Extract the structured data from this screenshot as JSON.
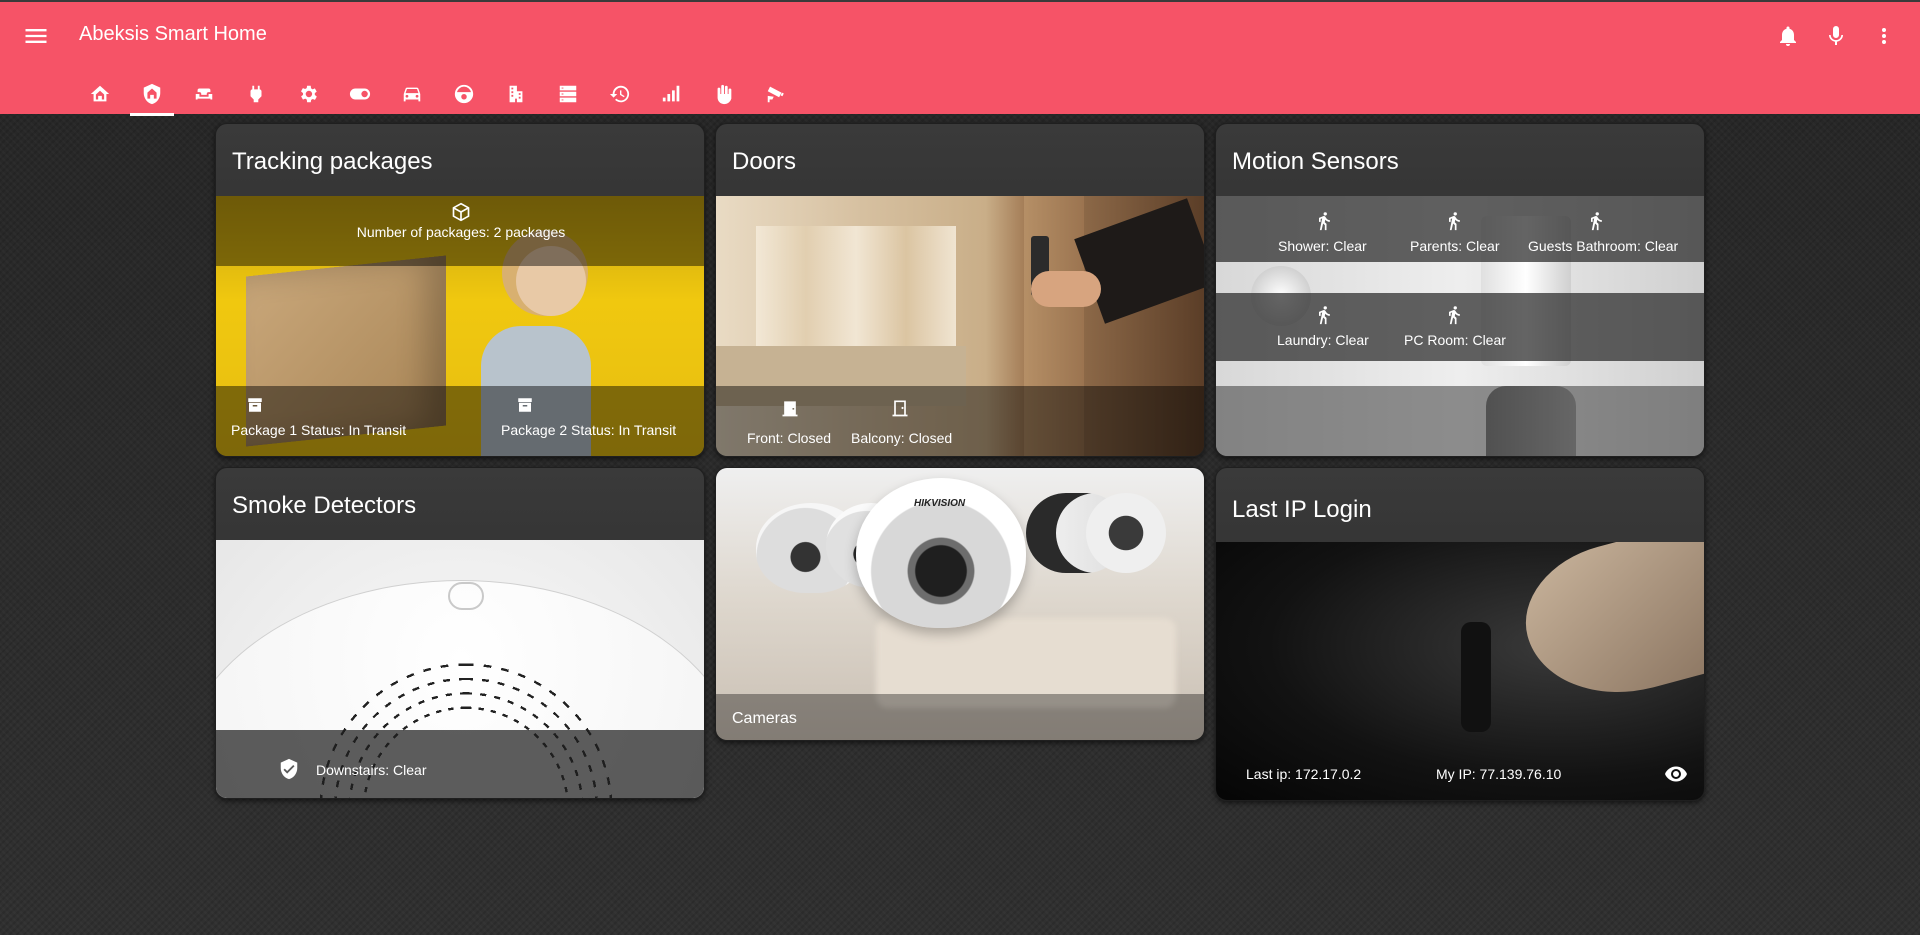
{
  "header": {
    "title": "Abeksis Smart Home",
    "icons": [
      "menu-icon",
      "bell-icon",
      "microphone-icon",
      "more-vert-icon"
    ],
    "background_color": "#f65367"
  },
  "tabs": [
    {
      "icon": "home-automation-icon",
      "active": false
    },
    {
      "icon": "home-shield-icon",
      "active": true
    },
    {
      "icon": "sofa-icon",
      "active": false
    },
    {
      "icon": "power-plug-icon",
      "active": false
    },
    {
      "icon": "cog-icon",
      "active": false
    },
    {
      "icon": "toggle-switch-icon",
      "active": false
    },
    {
      "icon": "car-icon",
      "active": false
    },
    {
      "icon": "robot-vacuum-icon",
      "active": false
    },
    {
      "icon": "office-building-icon",
      "active": false
    },
    {
      "icon": "server-icon",
      "active": false
    },
    {
      "icon": "history-icon",
      "active": false
    },
    {
      "icon": "signal-bars-icon",
      "active": false
    },
    {
      "icon": "hand-icon",
      "active": false
    },
    {
      "icon": "cctv-icon",
      "active": false
    }
  ],
  "cards": {
    "packages": {
      "title": "Tracking packages",
      "count": "Number of packages: 2 packages",
      "items": [
        "Package 1 Status: In Transit",
        "Package 2 Status: In Transit"
      ]
    },
    "doors": {
      "title": "Doors",
      "items": [
        "Front: Closed",
        "Balcony: Closed"
      ]
    },
    "motion": {
      "title": "Motion Sensors",
      "items": [
        "Shower: Clear",
        "Parents: Clear",
        "Guests Bathroom: Clear",
        "Laundry: Clear",
        "PC Room: Clear"
      ]
    },
    "smoke": {
      "title": "Smoke Detectors",
      "items": [
        "Downstairs: Clear"
      ]
    },
    "cameras": {
      "title": "Cameras",
      "brand": "HIKVISION"
    },
    "ip": {
      "title": "Last IP Login",
      "last_ip": "Last ip: 172.17.0.2",
      "my_ip": "My IP: 77.139.76.10"
    }
  }
}
